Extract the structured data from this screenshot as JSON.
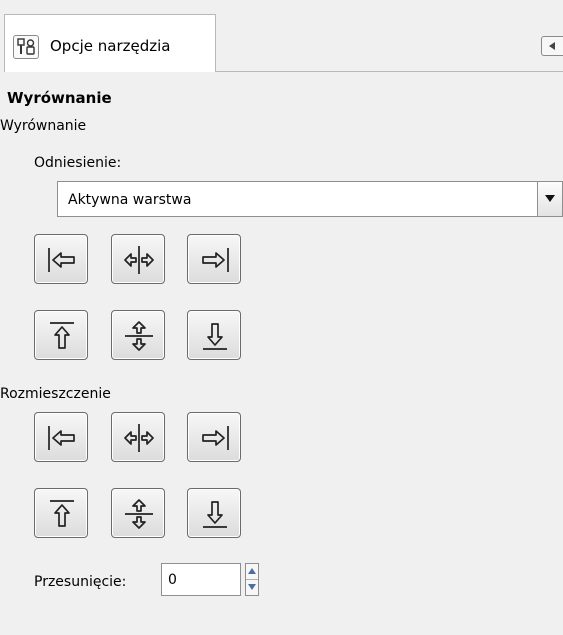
{
  "tab": {
    "icon": "tool-options-icon",
    "label": "Opcje narzędzia",
    "menu_icon": "tab-menu-arrow-icon"
  },
  "align_section": {
    "heading": "Wyrównanie",
    "group_label": "Wyrównanie",
    "reference_label": "Odniesienie:",
    "reference_value": "Aktywna warstwa",
    "dropdown_icon": "chevron-down-icon",
    "buttons_row1": [
      "align-left-edge-icon",
      "align-center-horizontal-icon",
      "align-right-edge-icon"
    ],
    "buttons_row2": [
      "align-top-edge-icon",
      "align-middle-vertical-icon",
      "align-bottom-edge-icon"
    ]
  },
  "distribute_section": {
    "label": "Rozmieszczenie",
    "buttons_row1": [
      "distribute-left-icon",
      "distribute-center-horizontal-icon",
      "distribute-right-icon"
    ],
    "buttons_row2": [
      "distribute-top-icon",
      "distribute-middle-vertical-icon",
      "distribute-bottom-icon"
    ],
    "offset_label": "Przesunięcie:",
    "offset_value": "0"
  }
}
